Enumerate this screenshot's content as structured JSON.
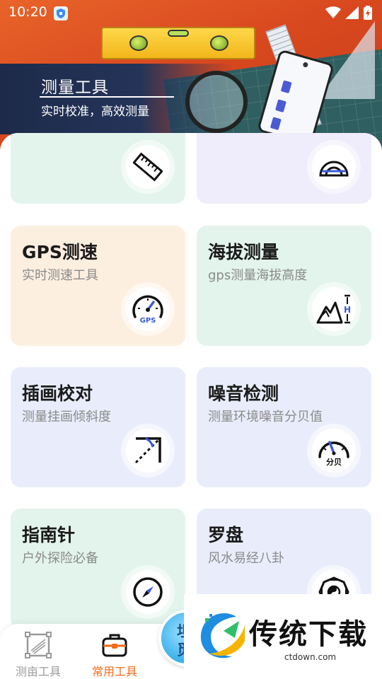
{
  "status_bar": {
    "time": "10:20"
  },
  "banner": {
    "title": "测量工具",
    "subtitle": "实时校准，高效测量"
  },
  "tools": [
    {
      "title": "",
      "subtitle": "",
      "icon": "ruler-icon",
      "bg": "#e3f4ec"
    },
    {
      "title": "",
      "subtitle": "",
      "icon": "protractor-icon",
      "bg": "#efecfb"
    },
    {
      "title": "GPS测速",
      "subtitle": "实时测速工具",
      "icon": "speedometer-gps-icon",
      "bg": "#fdefe0"
    },
    {
      "title": "海拔测量",
      "subtitle": "gps测量海拔高度",
      "icon": "mountain-height-icon",
      "bg": "#e3f4ec"
    },
    {
      "title": "插画校对",
      "subtitle": "测量挂画倾斜度",
      "icon": "angle-icon",
      "bg": "#e9edfb"
    },
    {
      "title": "噪音检测",
      "subtitle": "测量环境噪音分贝值",
      "icon": "decibel-meter-icon",
      "bg": "#e9edfb"
    },
    {
      "title": "指南针",
      "subtitle": "户外探险必备",
      "icon": "compass-icon",
      "bg": "#e3f4ec"
    },
    {
      "title": "罗盘",
      "subtitle": "风水易经八卦",
      "icon": "bagua-icon",
      "bg": "#e9edfb"
    }
  ],
  "icon_labels": {
    "gps": "GPS",
    "db": "分贝",
    "height": "H"
  },
  "bottom_nav": {
    "items": [
      {
        "label": "测亩工具",
        "active": false,
        "icon": "field-measure-icon"
      },
      {
        "label": "常用工具",
        "active": true,
        "icon": "toolbox-icon"
      }
    ],
    "fab_text": "坦觅"
  },
  "watermark": {
    "title": "传统下载",
    "url": "ctdown.com"
  },
  "colors": {
    "accent": "#f06a1a",
    "inactive_nav": "#9a9a9a",
    "icon_blue": "#3a5bd9"
  }
}
